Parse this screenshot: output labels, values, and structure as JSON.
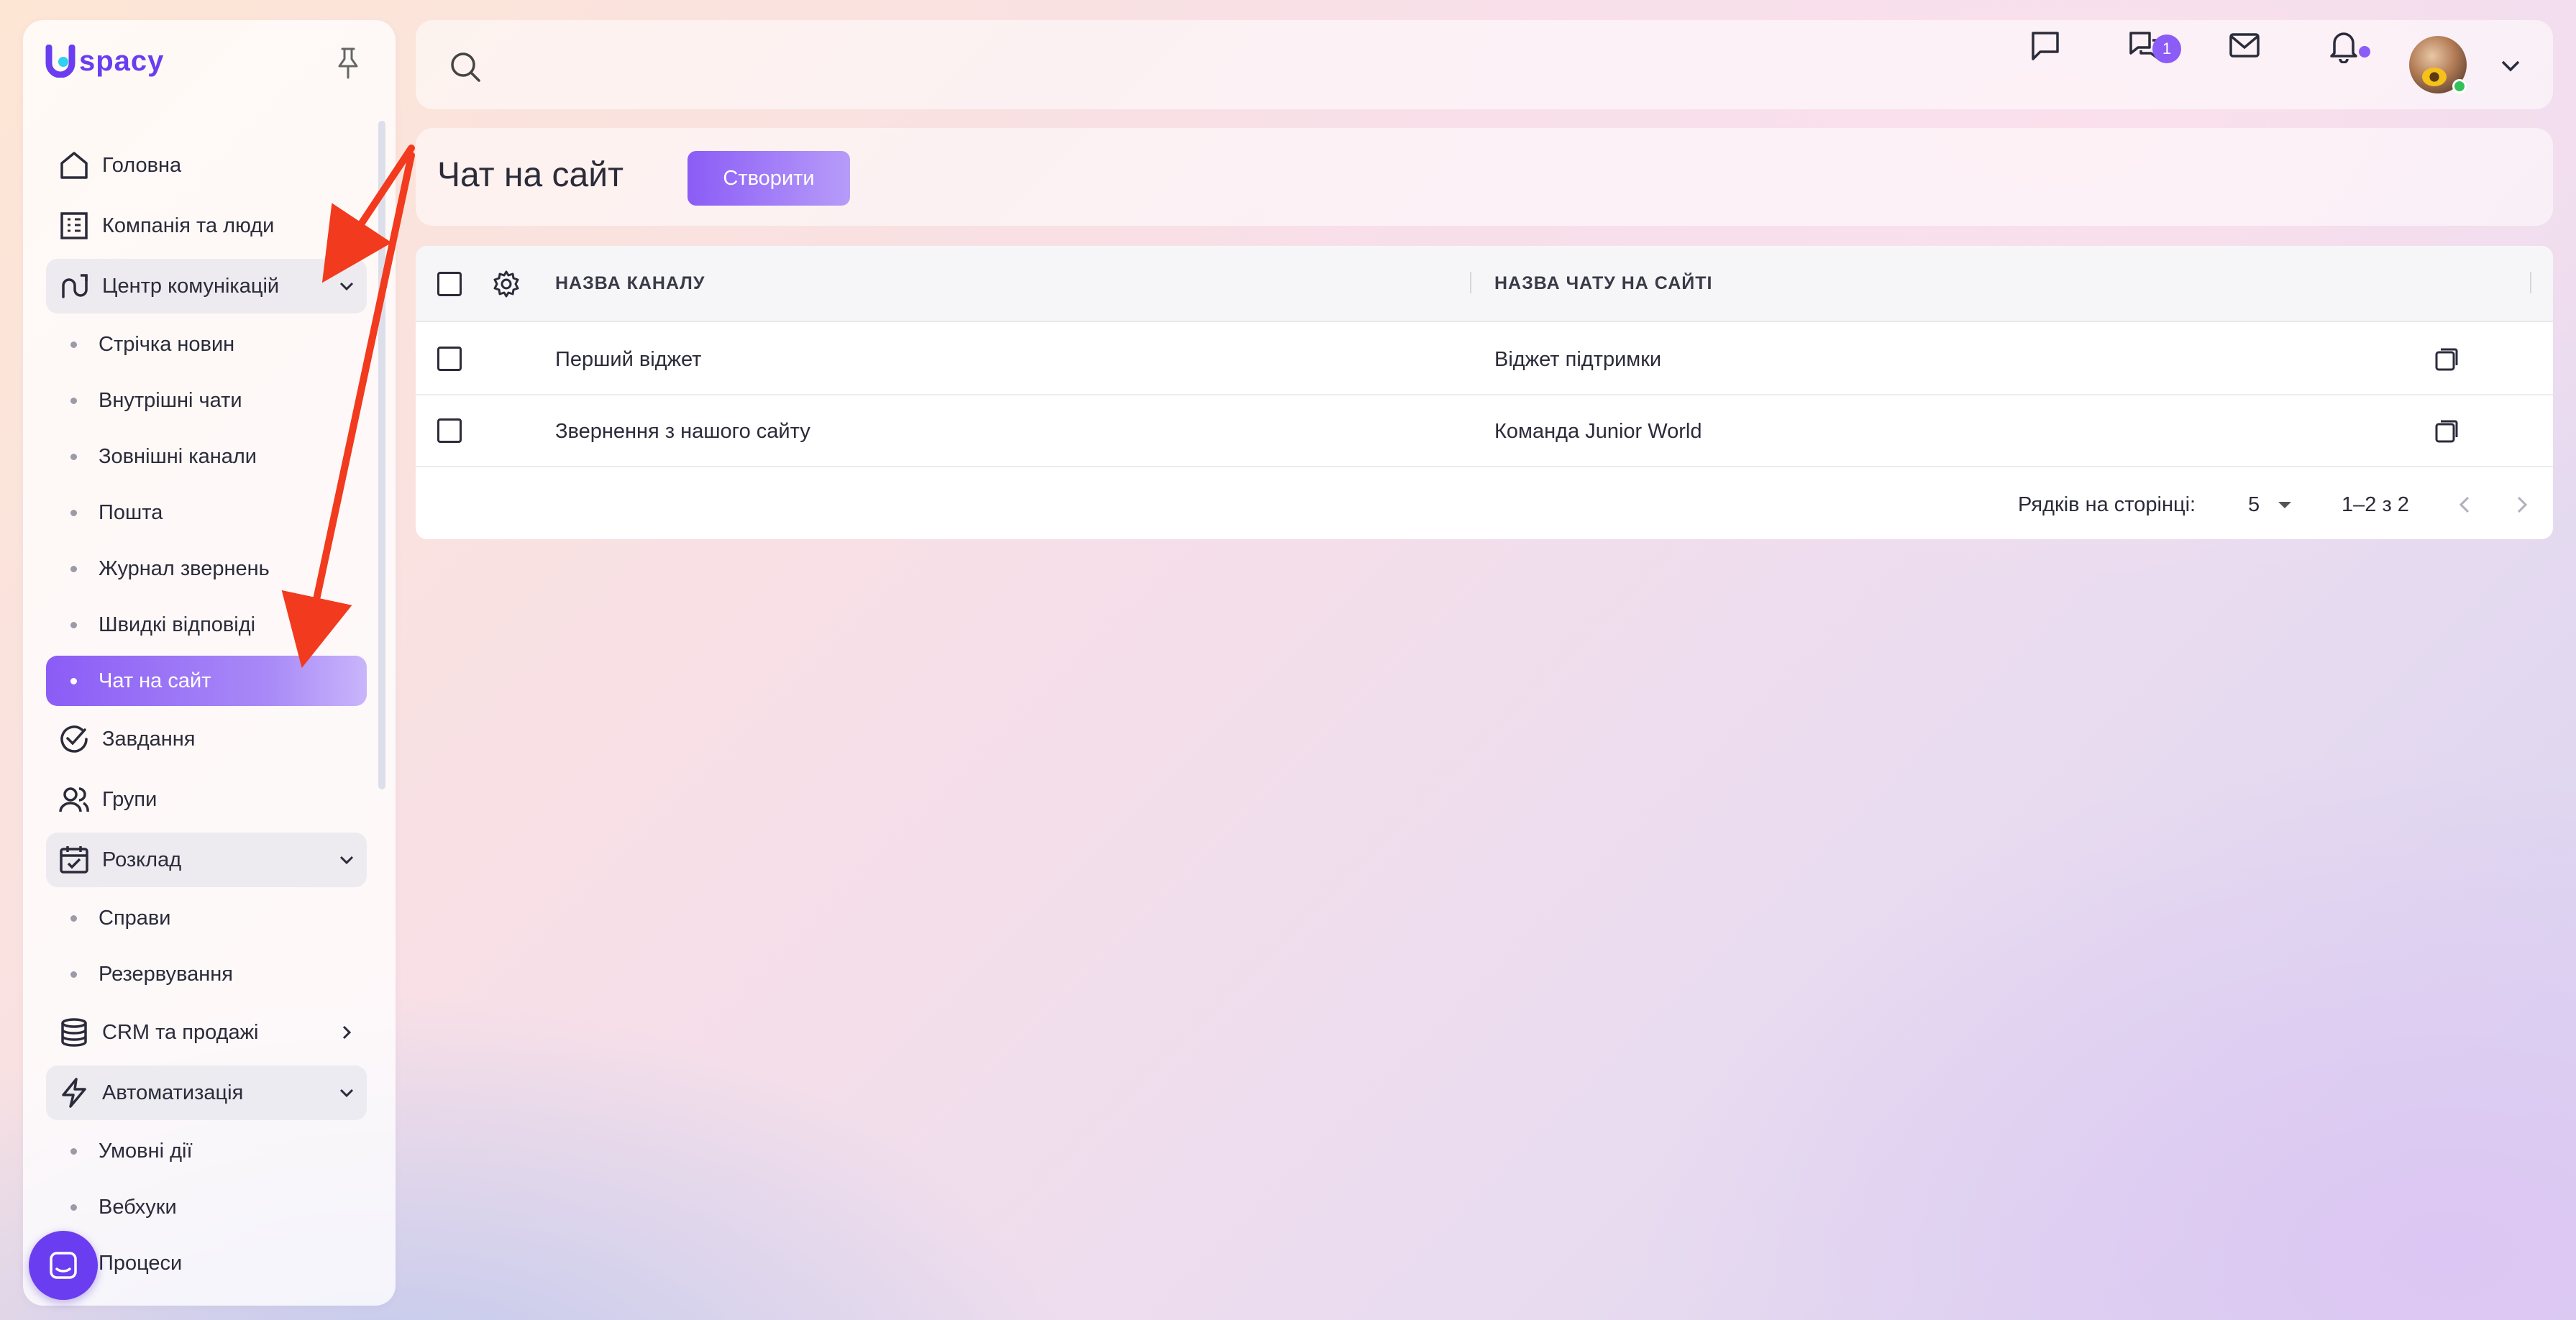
{
  "app": {
    "logo_text": "spacy",
    "brand_color": "#6a3df0",
    "accent_color": "#8b5cf6"
  },
  "sidebar": {
    "items": [
      {
        "label": "Головна",
        "icon": "home-icon"
      },
      {
        "label": "Компанія та люди",
        "icon": "building-icon"
      },
      {
        "label": "Центр комунікацій",
        "icon": "route-icon",
        "expanded": true,
        "children": [
          "Стрічка новин",
          "Внутрішні чати",
          "Зовнішні канали",
          "Пошта",
          "Журнал звернень",
          "Швидкі відповіді",
          "Чат на сайт"
        ]
      },
      {
        "label": "Завдання",
        "icon": "check-circle-icon"
      },
      {
        "label": "Групи",
        "icon": "users-icon"
      },
      {
        "label": "Розклад",
        "icon": "calendar-icon",
        "expanded": true,
        "children": [
          "Справи",
          "Резервування"
        ]
      },
      {
        "label": "CRM та продажі",
        "icon": "database-icon"
      },
      {
        "label": "Автоматизація",
        "icon": "lightning-icon",
        "expanded": true,
        "children": [
          "Умовні дії",
          "Вебхуки",
          "Процеси"
        ]
      }
    ],
    "active_item": "Чат на сайт"
  },
  "topbar": {
    "chat_badge": "1"
  },
  "page": {
    "title": "Чат на сайт",
    "create_label": "Створити"
  },
  "table": {
    "columns": [
      "НАЗВА КАНАЛУ",
      "НАЗВА ЧАТУ НА САЙТІ"
    ],
    "rows": [
      [
        "Перший віджет",
        "Віджет підтримки"
      ],
      [
        "Звернення з нашого сайту",
        "Команда Junior World"
      ]
    ],
    "rows_per_page_label": "Рядків на сторінці:",
    "rows_per_page_value": "5",
    "range_label": "1–2 з 2"
  }
}
